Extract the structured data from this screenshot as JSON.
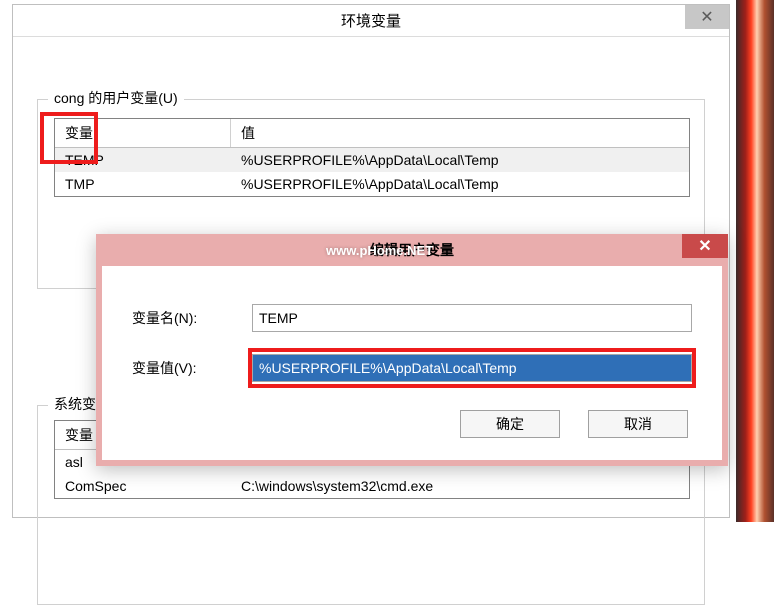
{
  "parent": {
    "title": "环境变量",
    "close_glyph": "✕",
    "user_group_label": "cong 的用户变量(U)",
    "sys_group_label": "系统变量",
    "columns": {
      "name": "变量",
      "value": "值"
    },
    "user_rows": [
      {
        "name": "TEMP",
        "value": "%USERPROFILE%\\AppData\\Local\\Temp"
      },
      {
        "name": "TMP",
        "value": "%USERPROFILE%\\AppData\\Local\\Temp"
      }
    ],
    "sys_rows": [
      {
        "name": "asl",
        "value": ""
      },
      {
        "name": "ComSpec",
        "value": "C:\\windows\\system32\\cmd.exe"
      }
    ]
  },
  "edit": {
    "title": "编辑用户变量",
    "watermark": "www.pHome.NET",
    "close_glyph": "✕",
    "name_label": "变量名(N):",
    "value_label": "变量值(V):",
    "name_value": "TEMP",
    "value_value": "%USERPROFILE%\\AppData\\Local\\Temp",
    "ok": "确定",
    "cancel": "取消"
  }
}
